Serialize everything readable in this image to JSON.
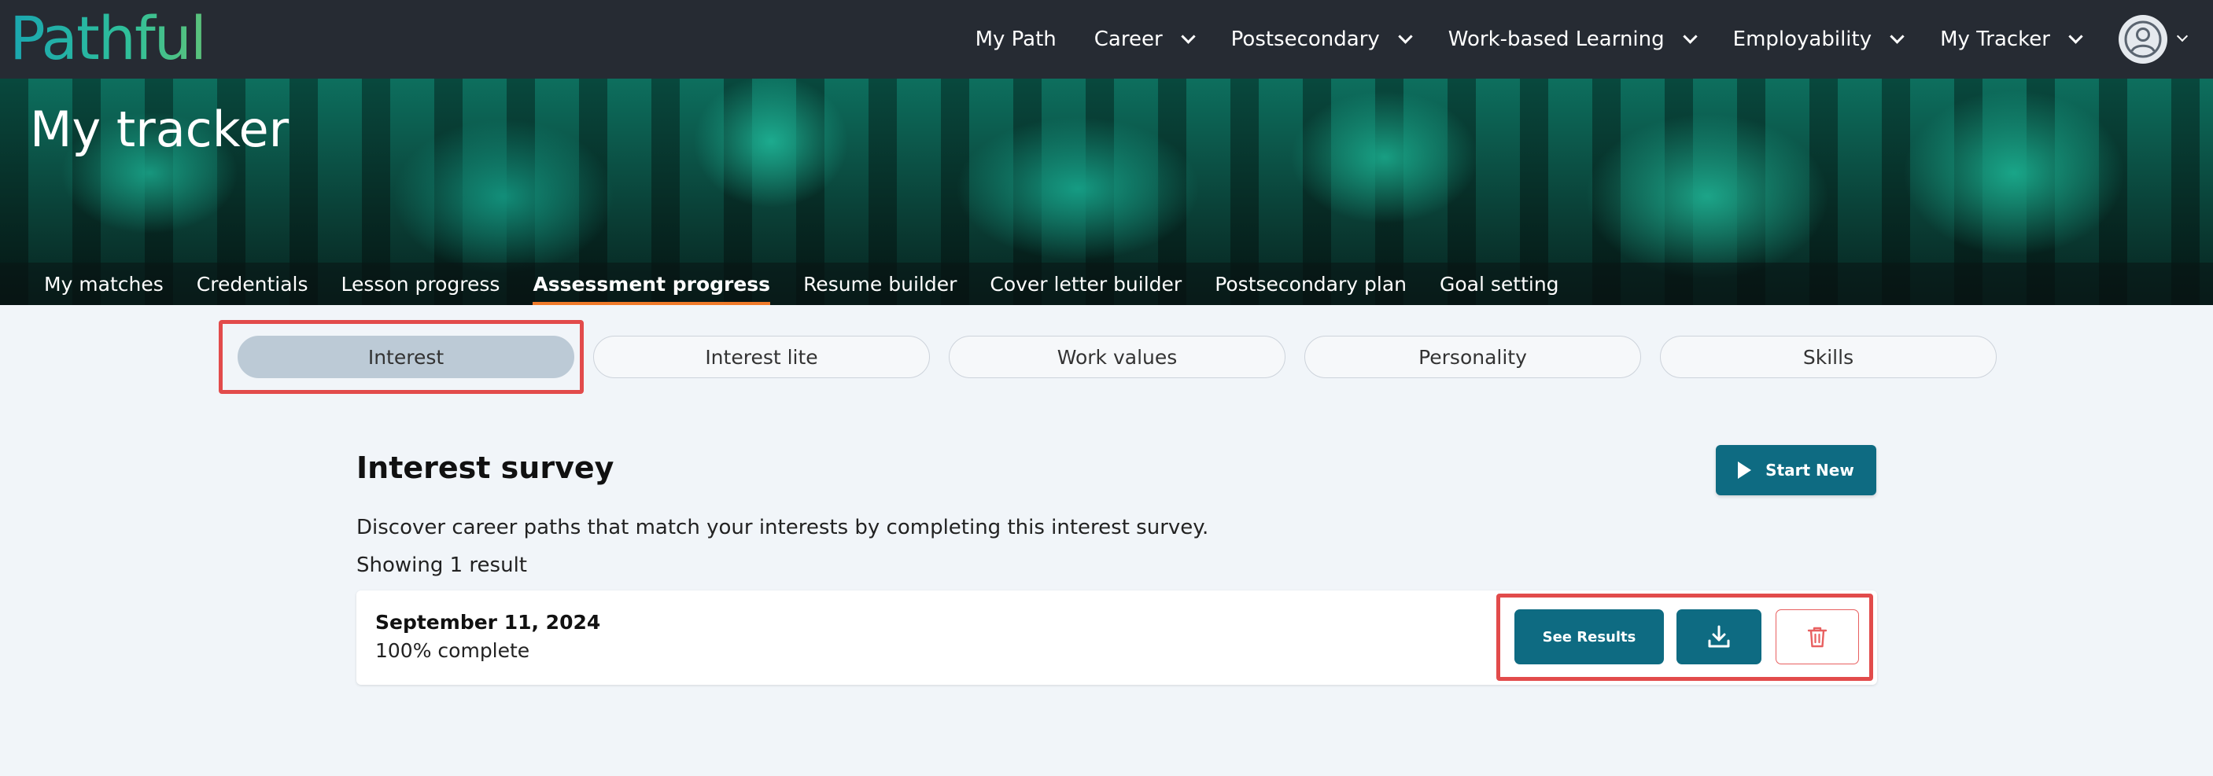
{
  "brand": {
    "logo_text": "Pathful",
    "logo_colors": [
      "#1aa6b0",
      "#5cc27a"
    ]
  },
  "nav": {
    "items": [
      {
        "label": "My Path",
        "dropdown": false
      },
      {
        "label": "Career",
        "dropdown": true
      },
      {
        "label": "Postsecondary",
        "dropdown": true
      },
      {
        "label": "Work-based Learning",
        "dropdown": true
      },
      {
        "label": "Employability",
        "dropdown": true
      },
      {
        "label": "My Tracker",
        "dropdown": true
      }
    ],
    "avatar_icon": "user-circle-icon"
  },
  "banner": {
    "title": "My tracker",
    "tabs": [
      {
        "label": "My matches",
        "active": false
      },
      {
        "label": "Credentials",
        "active": false
      },
      {
        "label": "Lesson progress",
        "active": false
      },
      {
        "label": "Assessment progress",
        "active": true
      },
      {
        "label": "Resume builder",
        "active": false
      },
      {
        "label": "Cover letter builder",
        "active": false
      },
      {
        "label": "Postsecondary plan",
        "active": false
      },
      {
        "label": "Goal setting",
        "active": false
      }
    ],
    "active_tab_accent": "#f07a2a"
  },
  "assessments": {
    "pills": [
      {
        "label": "Interest",
        "active": true
      },
      {
        "label": "Interest lite",
        "active": false
      },
      {
        "label": "Work values",
        "active": false
      },
      {
        "label": "Personality",
        "active": false
      },
      {
        "label": "Skills",
        "active": false
      }
    ]
  },
  "main": {
    "title": "Interest survey",
    "start_button": {
      "label": "Start New",
      "icon": "play-icon"
    },
    "description": "Discover career paths that match your interests by completing this interest survey.",
    "result_count": "Showing 1 result",
    "results": [
      {
        "date": "September 11, 2024",
        "status": "100% complete",
        "actions": {
          "see_results": "See Results",
          "download_icon": "download-icon",
          "delete_icon": "trash-icon"
        }
      }
    ]
  },
  "colors": {
    "primary": "#0e6b82",
    "highlight": "#e24b4b",
    "danger": "#e86060",
    "topbar": "#262b33"
  }
}
